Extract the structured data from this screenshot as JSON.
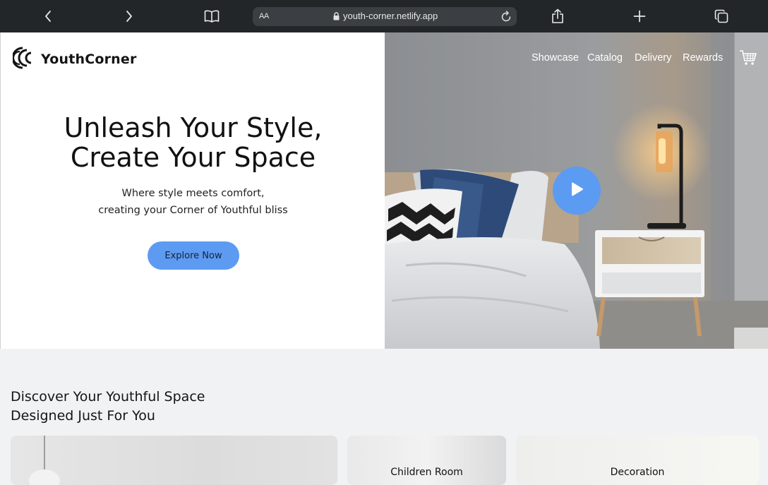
{
  "browser": {
    "text_size_label": "AA",
    "url": "youth-corner.netlify.app",
    "icons": [
      "back-chevron-icon",
      "forward-chevron-icon",
      "bookmarks-book-icon",
      "lock-icon",
      "reload-icon",
      "share-icon",
      "new-tab-plus-icon",
      "tabs-icon"
    ]
  },
  "brand": {
    "name": "YouthCorner",
    "logo_icon": "concentric-arcs-logo-icon"
  },
  "hero": {
    "title_line1": "Unleash Your Style,",
    "title_line2": "Create Your Space",
    "subtitle_line1": "Where style meets comfort,",
    "subtitle_line2": "creating your Corner of Youthful bliss",
    "cta_label": "Explore Now",
    "cta_color": "#5d9bf2"
  },
  "nav": {
    "items": [
      {
        "label": "Showcase"
      },
      {
        "label": "Catalog"
      },
      {
        "label": "Delivery"
      },
      {
        "label": "Rewards"
      }
    ],
    "cart_icon": "cart-icon",
    "play_icon": "play-icon",
    "play_color": "#5b9bf2"
  },
  "section": {
    "title_line1": "Discover Your Youthful Space",
    "title_line2": "Designed Just For You",
    "cards": [
      {
        "label": ""
      },
      {
        "label": "Children Room"
      },
      {
        "label": "Decoration"
      }
    ]
  }
}
